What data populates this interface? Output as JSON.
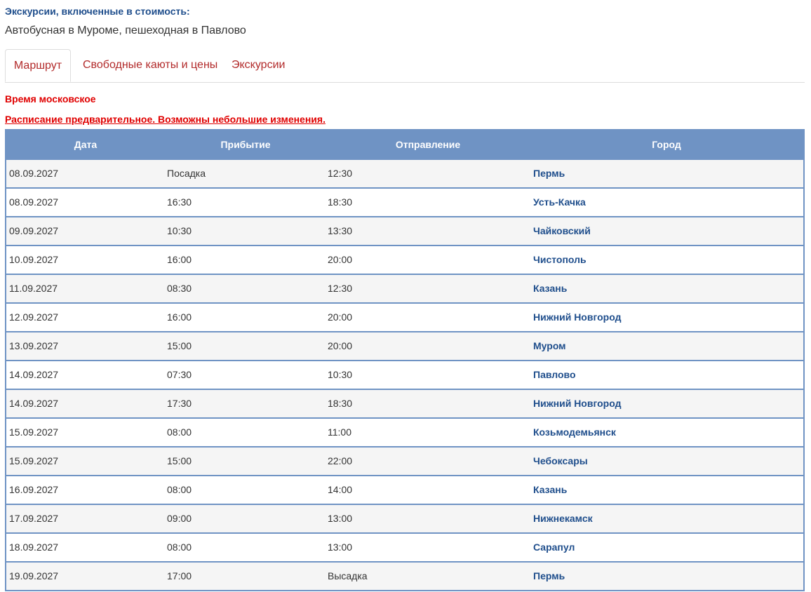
{
  "excursions": {
    "title": "Экскурсии, включенные в стоимость:",
    "text": "Автобусная в Муроме, пешеходная в Павлово"
  },
  "tabs": [
    {
      "label": "Маршрут",
      "active": true
    },
    {
      "label": "Свободные каюты и цены",
      "active": false
    },
    {
      "label": "Экскурсии",
      "active": false
    }
  ],
  "notes": {
    "time": "Время московское",
    "schedule": "Расписание предварительное. Возможны небольшие изменения."
  },
  "table": {
    "headers": {
      "date": "Дата",
      "arrival": "Прибытие",
      "departure": "Отправление",
      "city": "Город"
    },
    "rows": [
      {
        "date": "08.09.2027",
        "arrival": "Посадка",
        "departure": "12:30",
        "city": "Пермь"
      },
      {
        "date": "08.09.2027",
        "arrival": "16:30",
        "departure": "18:30",
        "city": "Усть-Качка"
      },
      {
        "date": "09.09.2027",
        "arrival": "10:30",
        "departure": "13:30",
        "city": "Чайковский"
      },
      {
        "date": "10.09.2027",
        "arrival": "16:00",
        "departure": "20:00",
        "city": "Чистополь"
      },
      {
        "date": "11.09.2027",
        "arrival": "08:30",
        "departure": "12:30",
        "city": "Казань"
      },
      {
        "date": "12.09.2027",
        "arrival": "16:00",
        "departure": "20:00",
        "city": "Нижний Новгород"
      },
      {
        "date": "13.09.2027",
        "arrival": "15:00",
        "departure": "20:00",
        "city": "Муром"
      },
      {
        "date": "14.09.2027",
        "arrival": "07:30",
        "departure": "10:30",
        "city": "Павлово"
      },
      {
        "date": "14.09.2027",
        "arrival": "17:30",
        "departure": "18:30",
        "city": "Нижний Новгород"
      },
      {
        "date": "15.09.2027",
        "arrival": "08:00",
        "departure": "11:00",
        "city": "Козьмодемьянск"
      },
      {
        "date": "15.09.2027",
        "arrival": "15:00",
        "departure": "22:00",
        "city": "Чебоксары"
      },
      {
        "date": "16.09.2027",
        "arrival": "08:00",
        "departure": "14:00",
        "city": "Казань"
      },
      {
        "date": "17.09.2027",
        "arrival": "09:00",
        "departure": "13:00",
        "city": "Нижнекамск"
      },
      {
        "date": "18.09.2027",
        "arrival": "08:00",
        "departure": "13:00",
        "city": "Сарапул"
      },
      {
        "date": "19.09.2027",
        "arrival": "17:00",
        "departure": "Высадка",
        "city": "Пермь"
      }
    ]
  },
  "colors": {
    "header_bg": "#6f93c4",
    "link": "#1f4e8c",
    "tab_text": "#b22a2a",
    "alert": "#e00000",
    "row_alt": "#f5f5f5"
  }
}
